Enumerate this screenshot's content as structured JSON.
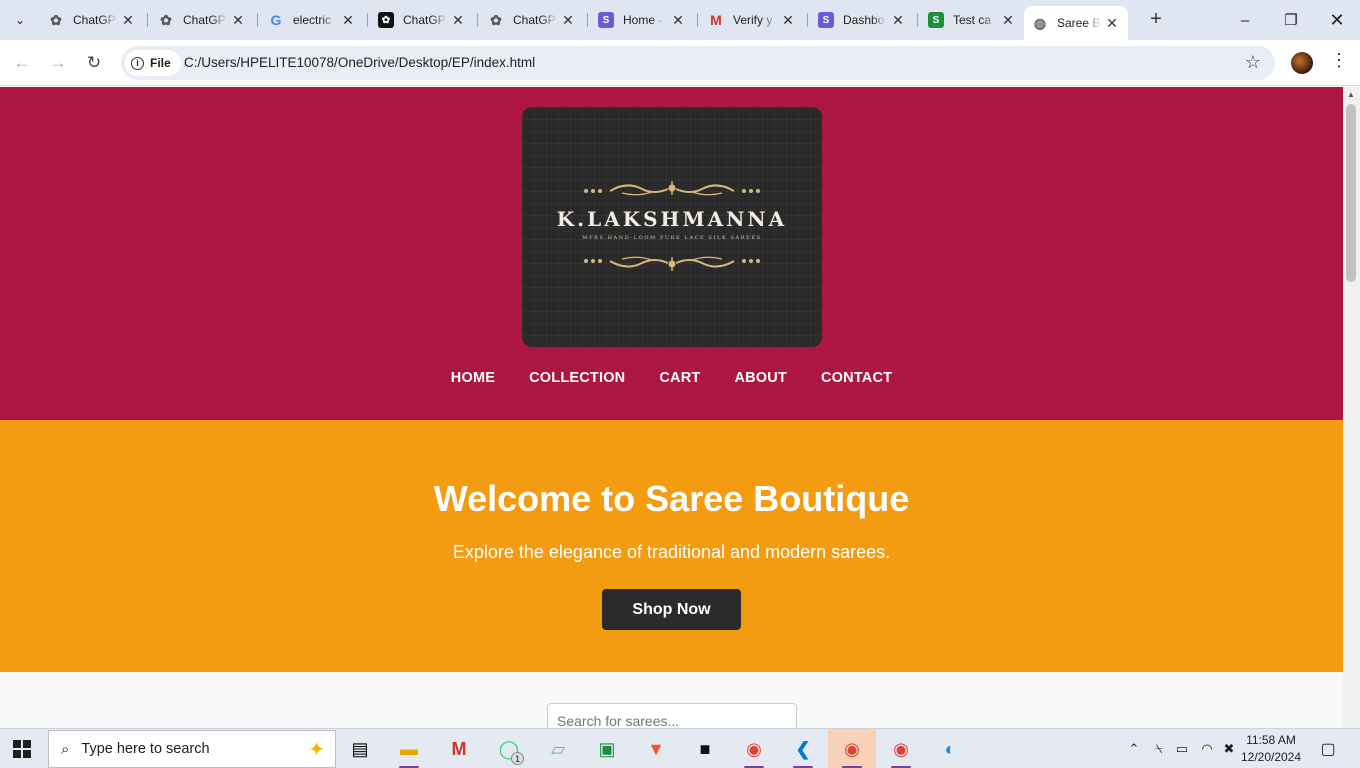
{
  "browser": {
    "tabs": [
      {
        "title": "ChatGPT",
        "icon": "chatgpt-icon",
        "color": "#5c5c5c"
      },
      {
        "title": "ChatGPT",
        "icon": "chatgpt-icon",
        "color": "#5c5c5c"
      },
      {
        "title": "electric",
        "icon": "google-icon",
        "color": "#4285f4"
      },
      {
        "title": "ChatGPT",
        "icon": "chatgpt-icon",
        "color": "#111111"
      },
      {
        "title": "ChatGPT",
        "icon": "chatgpt-icon",
        "color": "#5c5c5c"
      },
      {
        "title": "Home -",
        "icon": "s-app-icon",
        "color": "#6b5bd6"
      },
      {
        "title": "Verify y",
        "icon": "gmail-icon",
        "color": "#d93025"
      },
      {
        "title": "Dashbo",
        "icon": "s-app-icon",
        "color": "#6b5bd6"
      },
      {
        "title": "Test ca",
        "icon": "sheets-s-icon",
        "color": "#1e8e3e"
      },
      {
        "title": "Saree B",
        "icon": "globe-icon",
        "color": "#5f6368",
        "active": true
      }
    ],
    "site_chip": "File",
    "url": "C:/Users/HPELITE10078/OneDrive/Desktop/EP/index.html"
  },
  "site": {
    "logo": {
      "name": "K.LAKSHMANNA",
      "tagline": "MFRS.HAND-LOOM PURE LACE SILK SAREES"
    },
    "nav": [
      "HOME",
      "COLLECTION",
      "CART",
      "ABOUT",
      "CONTACT"
    ],
    "hero": {
      "title": "Welcome to Saree Boutique",
      "subtitle": "Explore the elegance of traditional and modern sarees.",
      "button": "Shop Now"
    },
    "search": {
      "placeholder": "Search for sarees..."
    },
    "colors": {
      "header": "#ad1642",
      "hero": "#f39c12",
      "button": "#2b2b2b"
    }
  },
  "taskbar": {
    "search_text": "Type here to search",
    "time": "11:58 AM",
    "date": "12/20/2024",
    "whatsapp_badge": "1"
  }
}
